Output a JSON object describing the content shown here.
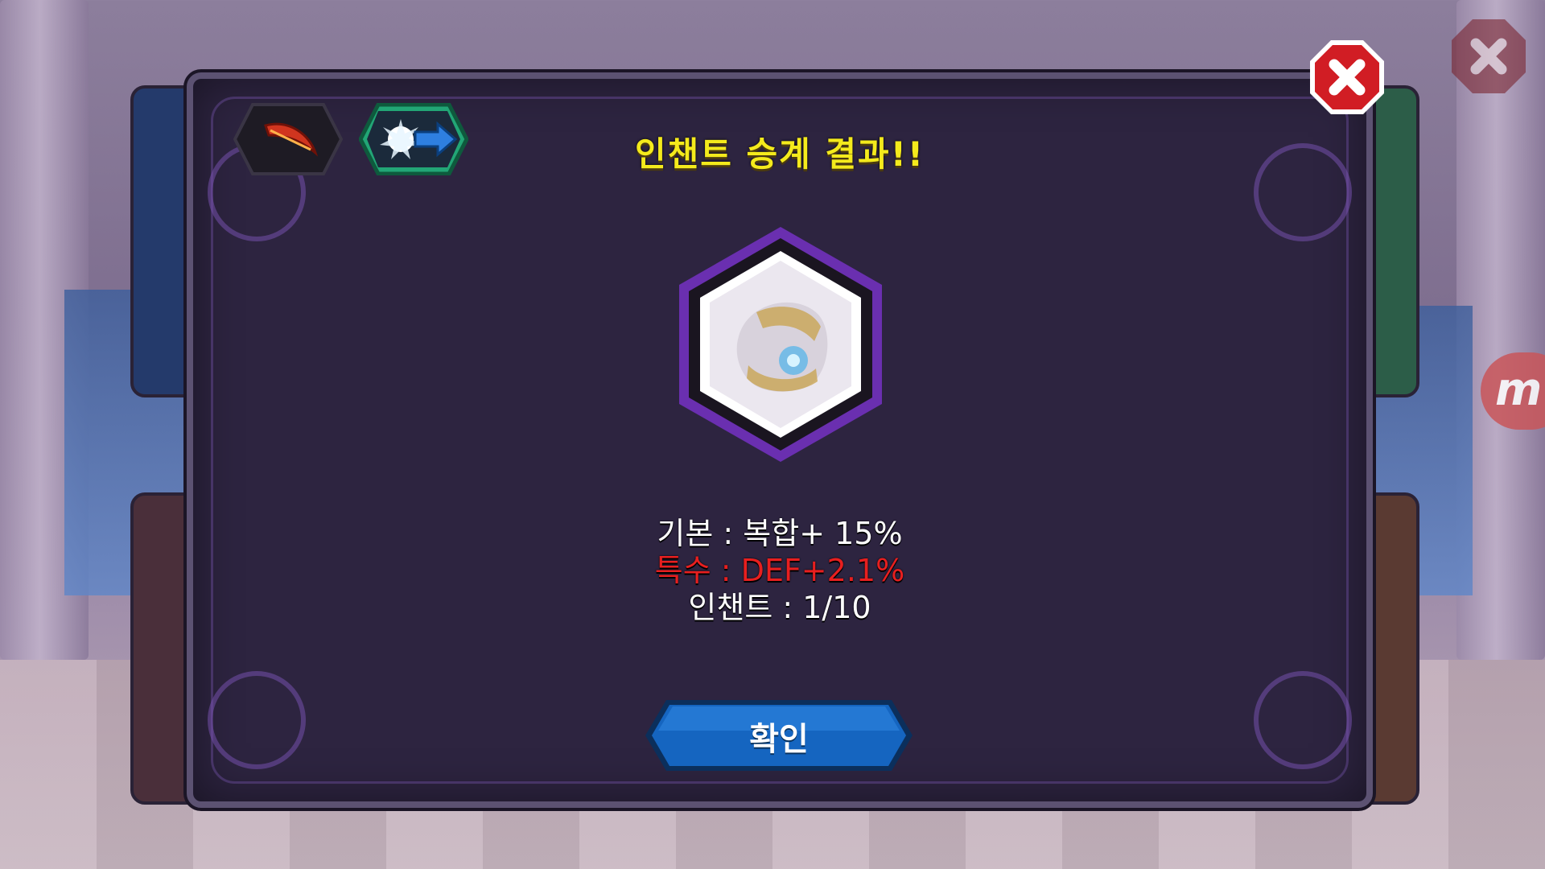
{
  "dialog": {
    "title": "인챈트 승계 결과!!",
    "stats": {
      "basic": "기본 : 복합+ 15%",
      "special": "특수 : DEF+2.1%",
      "enchant": "인챈트 : 1/10"
    },
    "confirm_label": "확인"
  },
  "side_badge": {
    "text": "m"
  },
  "colors": {
    "title": "#f4ea1c",
    "special_stat": "#e81f1f",
    "confirm_button": "#1565c0",
    "close_button": "#d11d24",
    "item_frame": "#6a2fb0"
  },
  "icons": {
    "tab_1": "feather-icon",
    "tab_2": "blast-arrow-icon",
    "close": "close-icon",
    "item": "armor-item-icon"
  }
}
